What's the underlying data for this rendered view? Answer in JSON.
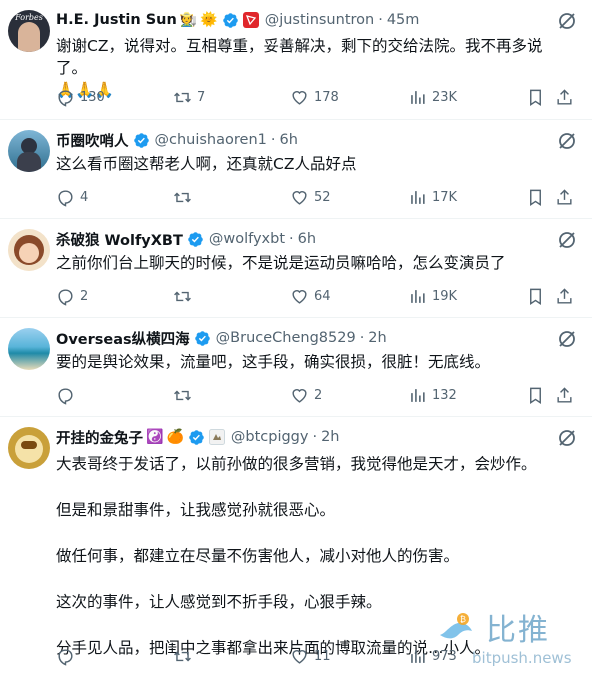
{
  "tweets": [
    {
      "name": "H.E. Justin Sun",
      "avatar_text": "Forbes",
      "emojis": [
        "🧑‍🌾",
        "🌞"
      ],
      "handle": "@justinsuntron",
      "time": "45m",
      "lines": [
        "谢谢CZ，说得对。互相尊重，妥善解决，剩下的交给法院。我不再多说了。",
        "🙏🙏🙏"
      ],
      "replies": "130",
      "retweets": "7",
      "likes": "178",
      "views": "23K"
    },
    {
      "name": "币圈吹哨人",
      "handle": "@chuishaoren1",
      "time": "6h",
      "lines": [
        "这么看币圈这帮老人啊，还真就CZ人品好点"
      ],
      "replies": "4",
      "retweets": "",
      "likes": "52",
      "views": "17K"
    },
    {
      "name": "杀破狼 WolfyXBT",
      "handle": "@wolfyxbt",
      "time": "6h",
      "lines": [
        "之前你们台上聊天的时候，不是说是运动员嘛哈哈，怎么变演员了"
      ],
      "replies": "2",
      "retweets": "",
      "likes": "64",
      "views": "19K"
    },
    {
      "name": "Overseas纵横四海",
      "handle": "@BruceCheng8529",
      "time": "2h",
      "lines": [
        "要的是舆论效果，流量吧，这手段，确实很损，很脏！无底线。"
      ],
      "replies": "",
      "retweets": "",
      "likes": "2",
      "views": "132"
    },
    {
      "name": "开挂的金兔子",
      "emojis": [
        "☯️",
        "🍊"
      ],
      "handle": "@btcpiggy",
      "time": "2h",
      "lines": [
        "大表哥终于发话了，以前孙做的很多营销，我觉得他是天才，会炒作。",
        "",
        "但是和景甜事件，让我感觉孙就很恶心。",
        "",
        "做任何事，都建立在尽量不伤害他人，减小对他人的伤害。",
        "",
        "这次的事件，让人感觉到不折手段，心狠手辣。",
        "",
        "分手见人品，把闺中之事都拿出来片面的博取流量的说…小人。"
      ],
      "replies": "",
      "retweets": "",
      "likes": "11",
      "views": "973"
    }
  ],
  "watermark": {
    "text": "比推",
    "url": "bitpush.news"
  },
  "colors": {
    "verified": "#1d9bf0",
    "muted": "#536471",
    "divider": "#eff3f4"
  }
}
